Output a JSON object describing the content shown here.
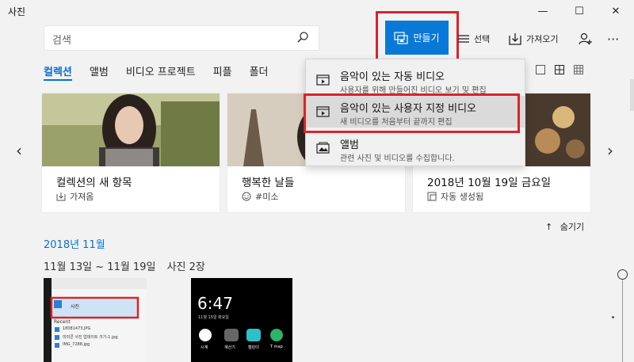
{
  "window": {
    "title": "사진"
  },
  "search": {
    "placeholder": "검색"
  },
  "toolbar": {
    "create_label": "만들기",
    "select_label": "선택",
    "import_label": "가져오기"
  },
  "tabs": [
    {
      "label": "컬렉션",
      "active": true
    },
    {
      "label": "앨범"
    },
    {
      "label": "비디오 프로젝트"
    },
    {
      "label": "피플"
    },
    {
      "label": "폴더"
    }
  ],
  "cards": [
    {
      "title": "컬렉션의 새 항목",
      "meta": "가져옴",
      "meta_icon": "import-icon"
    },
    {
      "title": "행복한 날들",
      "meta": "#미소",
      "meta_icon": "smile-icon"
    },
    {
      "title": "2018년 10월 19일 금요일",
      "meta": "자동 생성됨",
      "meta_icon": "auto-create-icon"
    }
  ],
  "hide_label": "숨기기",
  "section": {
    "heading": "2018년 11월",
    "range": "11월 13일 ~ 11월 19일",
    "count": "사진 2장"
  },
  "create_menu": {
    "items": [
      {
        "title": "음악이 있는 자동 비디오",
        "desc": "사용자를 위해 만들어진 비디오 보기 및 편집"
      },
      {
        "title": "음악이 있는 사용자 지정 비디오",
        "desc": "새 비디오를 처음부터 끝까지 편집"
      },
      {
        "title": "앨범",
        "desc": "관련 사진 및 비디오를 수집합니다."
      }
    ]
  },
  "thumb1": {
    "header_label": "사진",
    "recent_label": "Recent",
    "files": [
      "18081473.JPG",
      "미미콘 사진 업데이트 크기-1.jpg",
      "IMG_7288.jpg"
    ]
  },
  "thumb2": {
    "time": "6:47",
    "date": "11월 15일 화요일",
    "apps": [
      "시계",
      "계산기",
      "캘린더",
      "T map"
    ]
  },
  "colors": {
    "accent": "#0a78d7",
    "highlight_border": "#d9242b",
    "link_blue": "#0a6fce"
  }
}
